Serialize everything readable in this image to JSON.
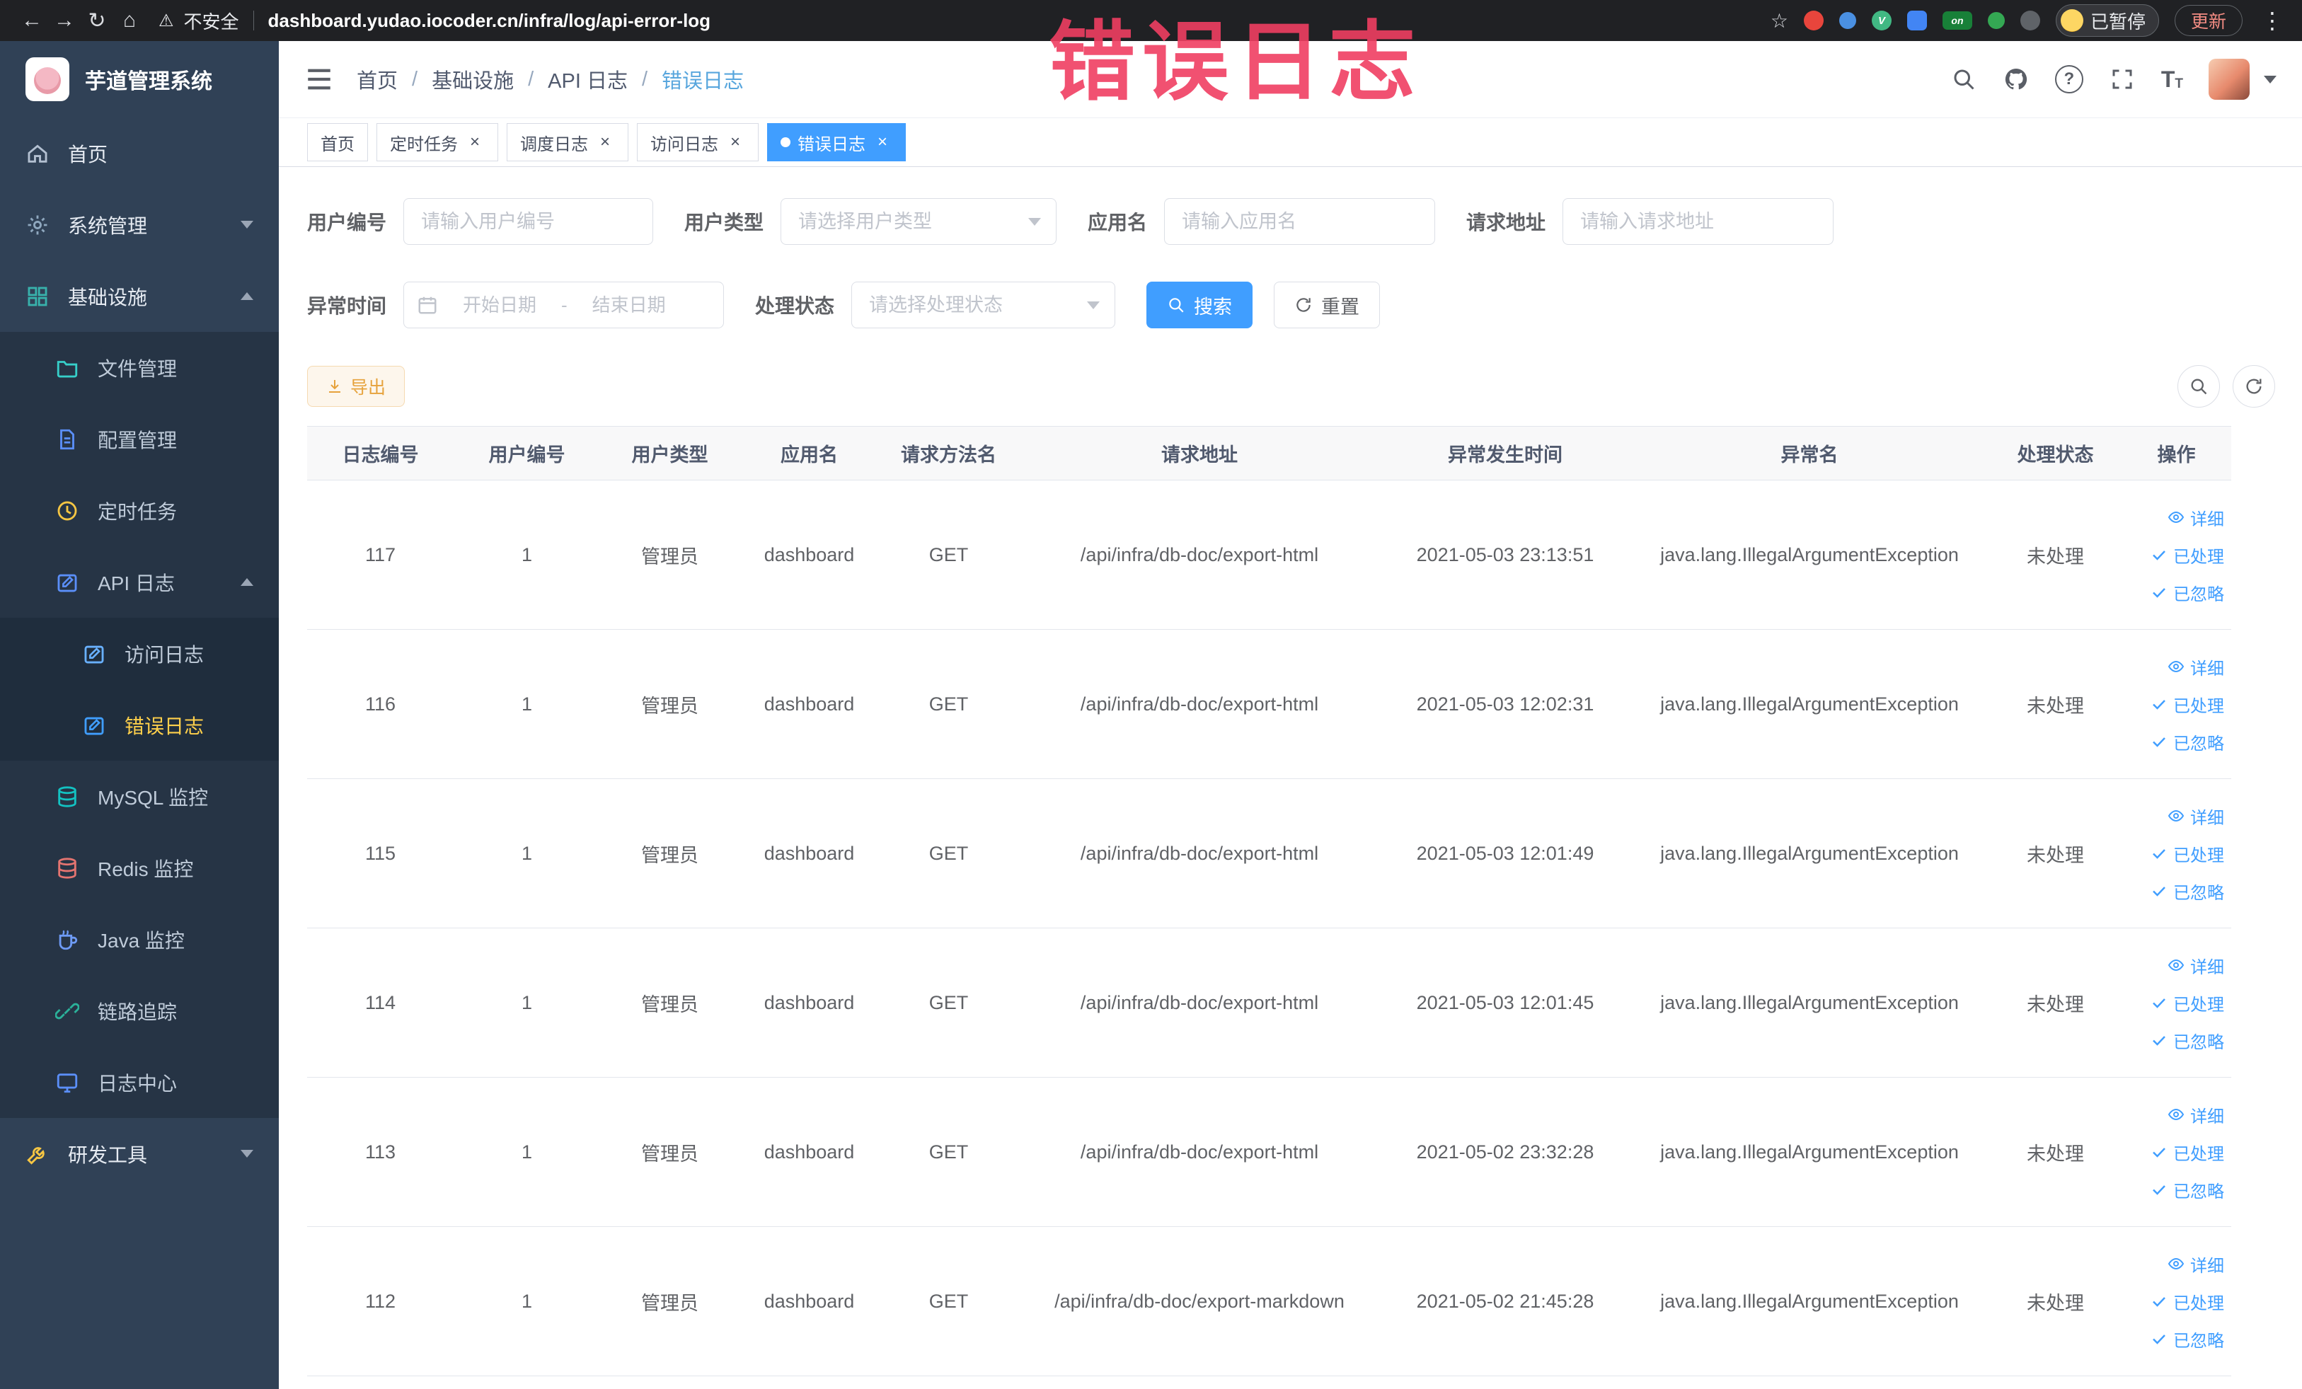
{
  "glyphs": {
    "back": "←",
    "forward": "→",
    "reload": "↻",
    "home": "⌂",
    "warning": "⚠",
    "star": "☆",
    "kebab": "⋮",
    "close": "×",
    "question": "?",
    "font_size": "T",
    "ext_v": "V",
    "ext_on": "on"
  },
  "browser": {
    "security_label": "不安全",
    "url": "dashboard.yudao.iocoder.cn/infra/log/api-error-log",
    "paused_badge": "已暂停",
    "update_label": "更新"
  },
  "annotation": {
    "text": "错误日志"
  },
  "sidebar": {
    "logo_title": "芋道管理系统",
    "items": {
      "home": "首页",
      "system": "系统管理",
      "infra": "基础设施",
      "file": "文件管理",
      "config": "配置管理",
      "job": "定时任务",
      "api_log": "API 日志",
      "access_log": "访问日志",
      "error_log": "错误日志",
      "mysql": "MySQL 监控",
      "redis": "Redis 监控",
      "java": "Java 监控",
      "trace": "链路追踪",
      "log_center": "日志中心",
      "dev_tools": "研发工具"
    }
  },
  "breadcrumb": {
    "separator": "/",
    "b0": "首页",
    "b1": "基础设施",
    "b2": "API 日志",
    "b3": "错误日志"
  },
  "tabs": {
    "t0": "首页",
    "t1": "定时任务",
    "t2": "调度日志",
    "t3": "访问日志",
    "t4": "错误日志"
  },
  "filters": {
    "user_id_label": "用户编号",
    "user_id_placeholder": "请输入用户编号",
    "user_type_label": "用户类型",
    "user_type_placeholder": "请选择用户类型",
    "app_name_label": "应用名",
    "app_name_placeholder": "请输入应用名",
    "request_url_label": "请求地址",
    "request_url_placeholder": "请输入请求地址",
    "exception_time_label": "异常时间",
    "start_date_placeholder": "开始日期",
    "date_separator": "-",
    "end_date_placeholder": "结束日期",
    "process_status_label": "处理状态",
    "process_status_placeholder": "请选择处理状态",
    "search_label": "搜索",
    "reset_label": "重置"
  },
  "toolbar": {
    "export_label": "导出"
  },
  "table": {
    "columns": [
      "日志编号",
      "用户编号",
      "用户类型",
      "应用名",
      "请求方法名",
      "请求地址",
      "异常发生时间",
      "异常名",
      "处理状态",
      "操作"
    ],
    "action_labels": {
      "detail": "详细",
      "processed": "已处理",
      "ignored": "已忽略"
    },
    "rows": [
      {
        "id": "117",
        "user_id": "1",
        "user_type": "管理员",
        "app": "dashboard",
        "method": "GET",
        "url": "/api/infra/db-doc/export-html",
        "time": "2021-05-03 23:13:51",
        "exception": "java.lang.IllegalArgumentException",
        "status": "未处理"
      },
      {
        "id": "116",
        "user_id": "1",
        "user_type": "管理员",
        "app": "dashboard",
        "method": "GET",
        "url": "/api/infra/db-doc/export-html",
        "time": "2021-05-03 12:02:31",
        "exception": "java.lang.IllegalArgumentException",
        "status": "未处理"
      },
      {
        "id": "115",
        "user_id": "1",
        "user_type": "管理员",
        "app": "dashboard",
        "method": "GET",
        "url": "/api/infra/db-doc/export-html",
        "time": "2021-05-03 12:01:49",
        "exception": "java.lang.IllegalArgumentException",
        "status": "未处理"
      },
      {
        "id": "114",
        "user_id": "1",
        "user_type": "管理员",
        "app": "dashboard",
        "method": "GET",
        "url": "/api/infra/db-doc/export-html",
        "time": "2021-05-03 12:01:45",
        "exception": "java.lang.IllegalArgumentException",
        "status": "未处理"
      },
      {
        "id": "113",
        "user_id": "1",
        "user_type": "管理员",
        "app": "dashboard",
        "method": "GET",
        "url": "/api/infra/db-doc/export-html",
        "time": "2021-05-02 23:32:28",
        "exception": "java.lang.IllegalArgumentException",
        "status": "未处理"
      },
      {
        "id": "112",
        "user_id": "1",
        "user_type": "管理员",
        "app": "dashboard",
        "method": "GET",
        "url": "/api/infra/db-doc/export-markdown",
        "time": "2021-05-02 21:45:28",
        "exception": "java.lang.IllegalArgumentException",
        "status": "未处理"
      }
    ]
  },
  "theme": {
    "primary": "#409EFF",
    "sidebar_bg": "#304156",
    "chrome_bg": "#202124",
    "annotation_color": "#f0456b",
    "warning_text": "#e6a23c"
  }
}
